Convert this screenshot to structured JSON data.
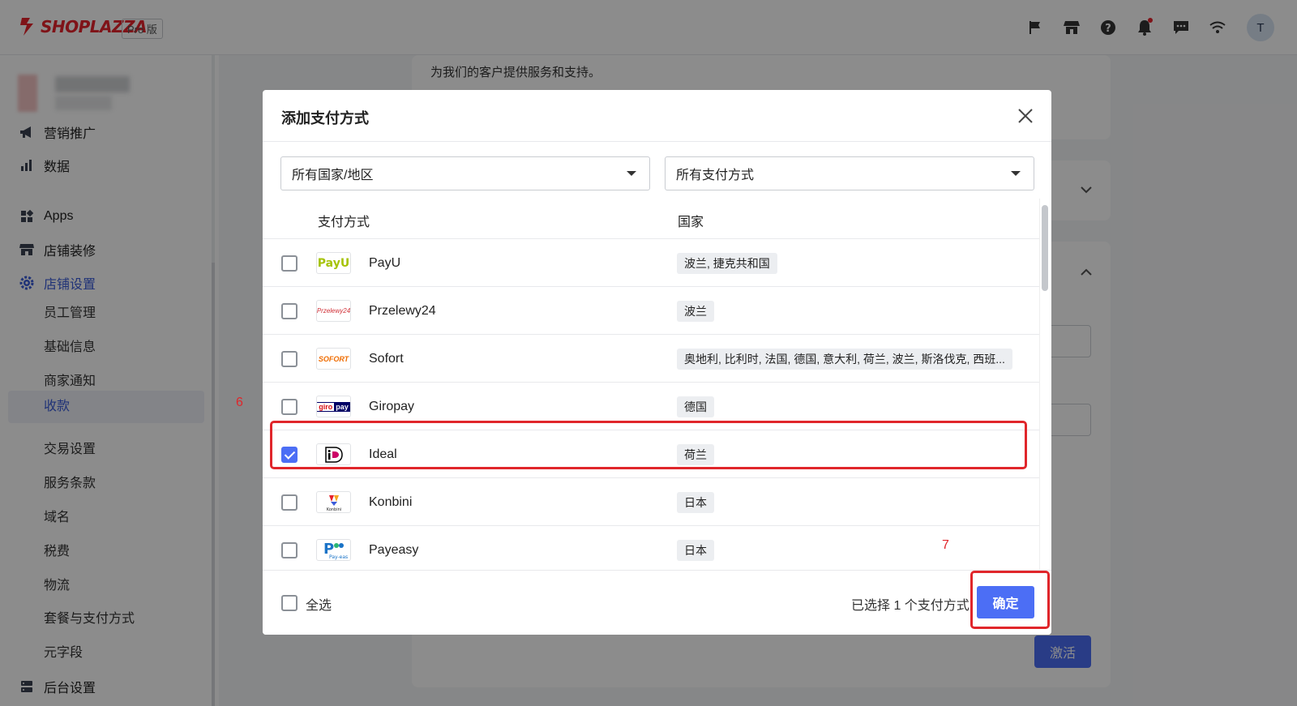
{
  "app": {
    "brand": "SHOPLAZZA",
    "plan_badge": "Pro 版",
    "avatar_initial": "T"
  },
  "sidebar": {
    "items": [
      {
        "label": "营销推广",
        "icon": "megaphone-icon"
      },
      {
        "label": "数据",
        "icon": "bar-chart-icon"
      },
      {
        "label": "Apps",
        "icon": "apps-grid-icon"
      },
      {
        "label": "店铺装修",
        "icon": "storefront-icon"
      },
      {
        "label": "店铺设置",
        "icon": "gear-icon"
      }
    ],
    "sub_items": [
      {
        "label": "员工管理"
      },
      {
        "label": "基础信息"
      },
      {
        "label": "商家通知"
      },
      {
        "label": "收款"
      },
      {
        "label": "交易设置"
      },
      {
        "label": "服务条款"
      },
      {
        "label": "域名"
      },
      {
        "label": "税费"
      },
      {
        "label": "物流"
      },
      {
        "label": "套餐与支付方式"
      },
      {
        "label": "元字段"
      }
    ],
    "bottom_item": {
      "label": "后台设置",
      "icon": "server-icon"
    }
  },
  "background": {
    "card_text": "为我们的客户提供服务和支持。",
    "activate_button": "激活"
  },
  "modal": {
    "title": "添加支付方式",
    "filters": {
      "country": "所有国家/地区",
      "method": "所有支付方式"
    },
    "columns": {
      "method": "支付方式",
      "country": "国家"
    },
    "rows": [
      {
        "name": "PayU",
        "countries": "波兰, 捷克共和国",
        "checked": false,
        "logo": "payu-logo"
      },
      {
        "name": "Przelewy24",
        "countries": "波兰",
        "checked": false,
        "logo": "przelewy24-logo"
      },
      {
        "name": "Sofort",
        "countries": "奥地利, 比利时, 法国, 德国, 意大利, 荷兰, 波兰, 斯洛伐克, 西班...",
        "checked": false,
        "logo": "sofort-logo"
      },
      {
        "name": "Giropay",
        "countries": "德国",
        "checked": false,
        "logo": "giropay-logo"
      },
      {
        "name": "Ideal",
        "countries": "荷兰",
        "checked": true,
        "logo": "ideal-logo"
      },
      {
        "name": "Konbini",
        "countries": "日本",
        "checked": false,
        "logo": "konbini-logo"
      },
      {
        "name": "Payeasy",
        "countries": "日本",
        "checked": false,
        "logo": "payeasy-logo"
      }
    ],
    "footer": {
      "select_all": "全选",
      "selected_count": "已选择 1 个支付方式",
      "confirm": "确定"
    }
  },
  "annotations": {
    "step6": "6",
    "step7": "7"
  },
  "colors": {
    "accent": "#4c6ef5",
    "brand_red": "#e8232c",
    "annotation_red": "#e0262b",
    "overlay": "rgba(0,0,0,0.45)"
  }
}
